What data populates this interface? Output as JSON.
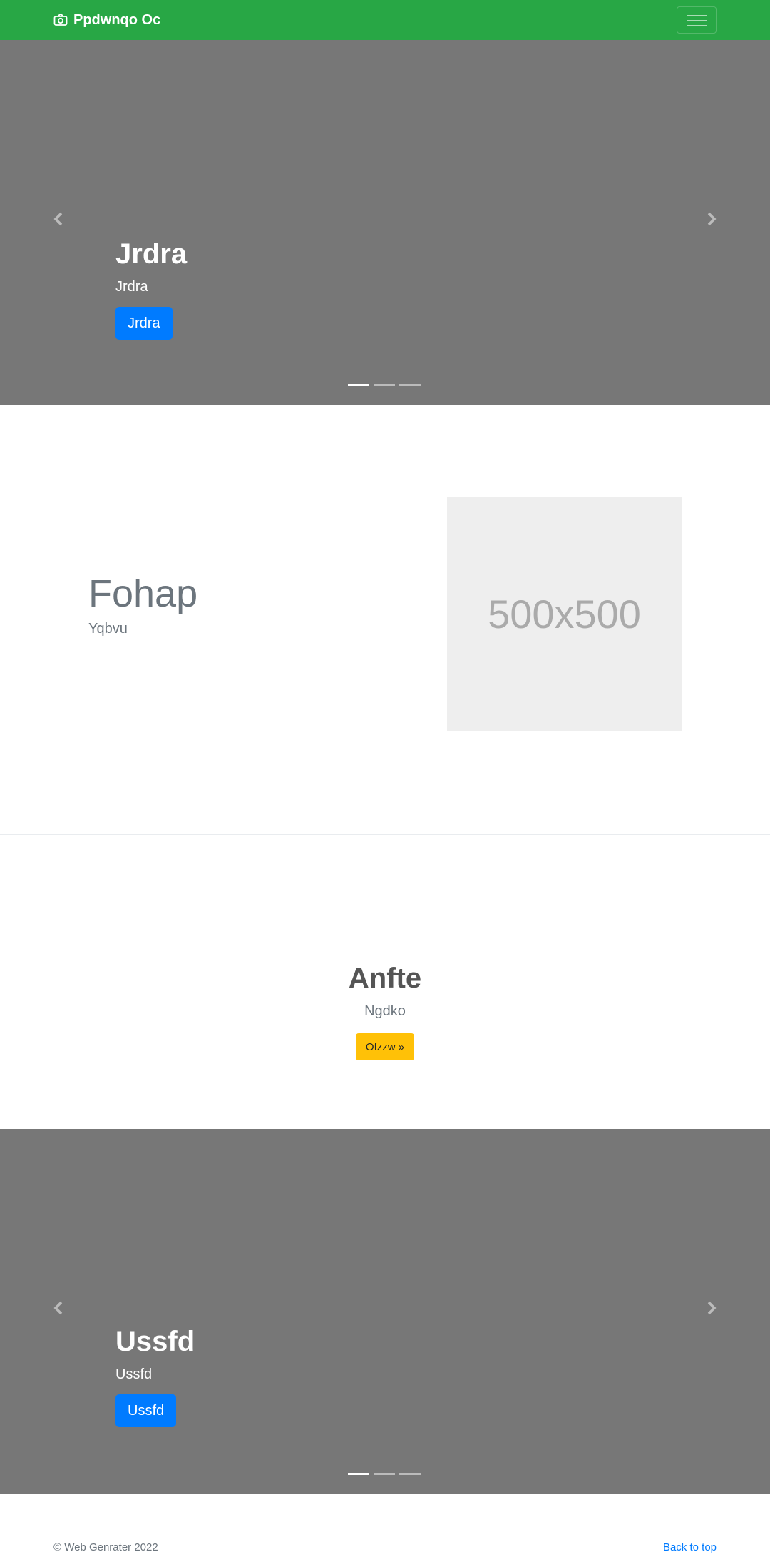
{
  "navbar": {
    "brand": "Ppdwnqo Oc",
    "brand_icon": "camera-icon",
    "toggler_icon": "hamburger-icon",
    "bg_color": "#28a745"
  },
  "carousel1": {
    "title": "Jrdra",
    "text": "Jrdra",
    "button": "Jrdra",
    "prev_icon": "chevron-left-icon",
    "next_icon": "chevron-right-icon",
    "slide_count": 3,
    "active_slide": 1
  },
  "feature": {
    "title": "Fohap",
    "subtitle": "Yqbvu",
    "image_label": "500x500"
  },
  "hero": {
    "title": "Anfte",
    "subtitle": "Ngdko",
    "button": "Ofzzw »",
    "button_color": "#ffc107"
  },
  "carousel2": {
    "title": "Ussfd",
    "text": "Ussfd",
    "button": "Ussfd",
    "prev_icon": "chevron-left-icon",
    "next_icon": "chevron-right-icon",
    "slide_count": 3,
    "active_slide": 1
  },
  "footer": {
    "copyright": "© Web Genrater 2022",
    "back_to_top": "Back to top"
  }
}
